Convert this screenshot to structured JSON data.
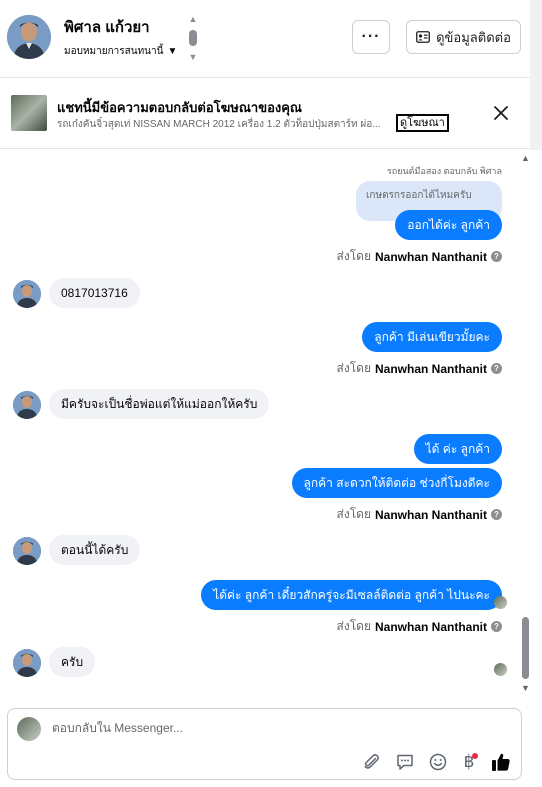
{
  "header": {
    "contact_name": "พิศาล แก้วยา",
    "assign_label": "มอบหมายการสนทนานี้",
    "more_label": "···",
    "contact_info_label": "ดูข้อมูลติดต่อ"
  },
  "ad_banner": {
    "title": "แชทนี้มีข้อความตอบกลับต่อโฆษณาของคุณ",
    "description": "รถเก๋งคันจิ๋วสุดเท่ NISSAN MARCH 2012 เครื่อง 1.2 ตัวท็อปปุ่มสตาร์ท ผ่อ...",
    "link_label": "ดูโฆษณา"
  },
  "thread": {
    "reply_reference": "รถยนต์มือสอง ตอบกลับ พิศาล",
    "quoted_text": "เกษตรกรออกได้ไหมครับ",
    "sent_by_prefix": "ส่งโดย",
    "agent_name": "Nanwhan Nanthanit",
    "messages": [
      {
        "text": "ออกได้ค่ะ  ลูกค้า"
      },
      {
        "text": "0817013716"
      },
      {
        "text": "ลูกค้า มีเล่นเขียวมั้ยคะ"
      },
      {
        "text": "มีครับจะเป็นชื่อพ่อแต่ให้แม่ออกให้ครับ"
      },
      {
        "text": "ได้ ค่ะ  ลูกค้า"
      },
      {
        "text": "ลูกค้า สะดวกให้ติดต่อ ช่วงกี่โมงดีคะ"
      },
      {
        "text": "ตอนนี้ได้ครับ"
      },
      {
        "text": "ได้ค่ะ  ลูกค้า เดี๋ยวสักครู่จะมีเซลล์ติดต่อ ลูกค้า ไปนะคะ"
      },
      {
        "text": "ครับ"
      }
    ]
  },
  "composer": {
    "placeholder": "ตอบกลับใน Messenger..."
  },
  "colors": {
    "outgoing_bubble": "#0a7cff",
    "incoming_bubble": "#f0f2f5",
    "quoted_bubble": "#dbe7f9",
    "notification_dot": "#f02849"
  },
  "icons": [
    "chevron-up-icon",
    "chevron-down-icon",
    "more-icon",
    "contact-card-icon",
    "close-icon",
    "help-icon",
    "attach-icon",
    "saved-reply-icon",
    "emoji-icon",
    "payment-icon",
    "like-icon"
  ]
}
